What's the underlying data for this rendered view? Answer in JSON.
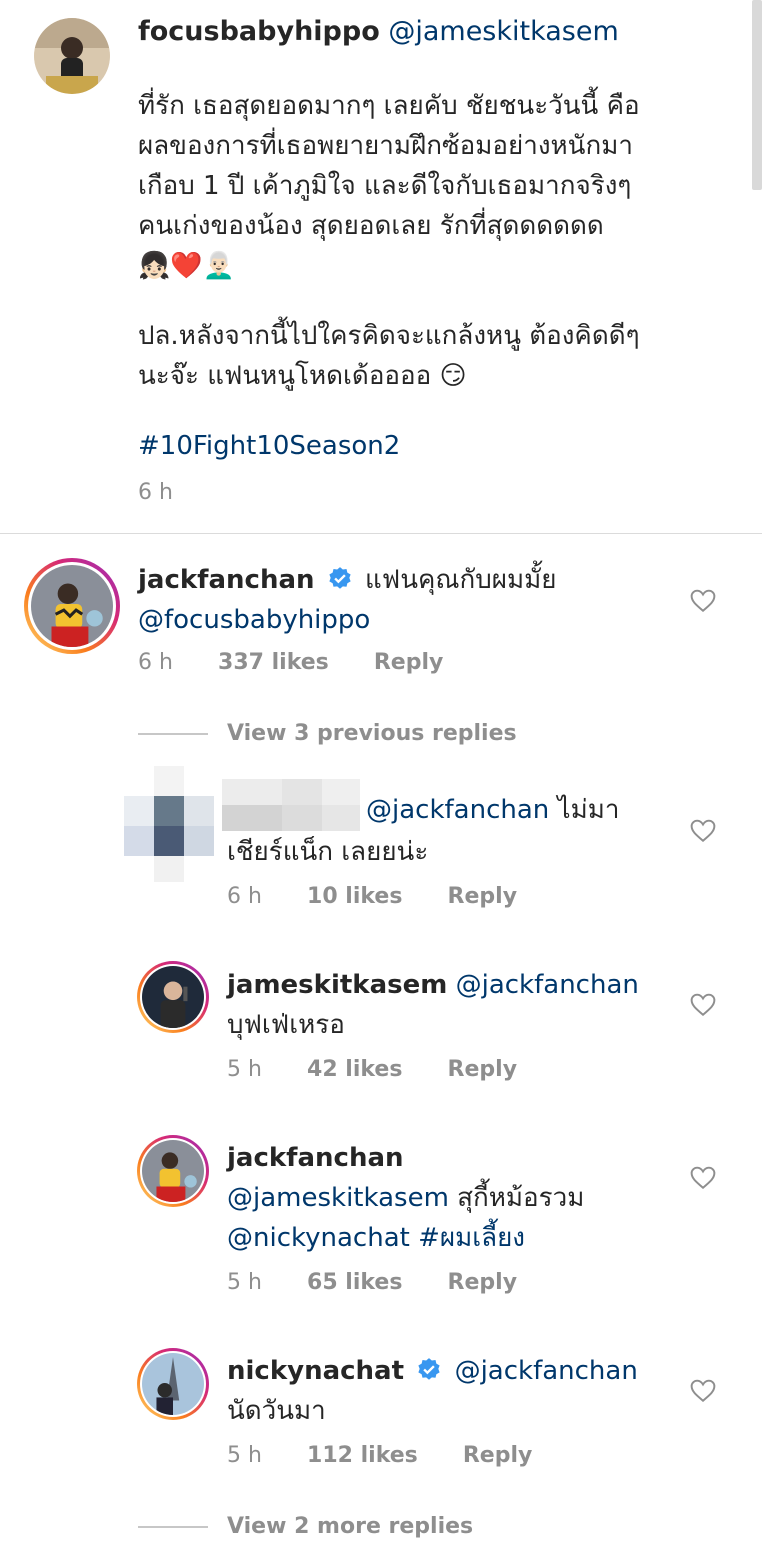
{
  "caption": {
    "username": "focusbabyhippo",
    "mention": "@jameskitkasem",
    "lines": [
      "ที่รัก เธอสุดยอดมากๆ เลยคับ ชัยชนะวันนี้ คือ",
      "ผลของการที่เธอพยายามฝึกซ้อมอย่างหนักมา",
      "เกือบ 1 ปี เค้าภูมิใจ และดีใจกับเธอมากจริงๆ",
      "คนเก่งของน้อง สุดยอดเลย รักที่สุดดดดดด",
      "👧🏻❤️👨🏻‍🦳"
    ],
    "ps_lines": [
      "ปล.หลังจากนี้ไปใครคิดจะแกล้งหนู ต้องคิดดีๆ",
      "นะจ๊ะ แฟนหนูโหดเด้ออออ 😏"
    ],
    "hashtag": "#10Fight10Season2",
    "time": "6 h"
  },
  "comments": [
    {
      "username": "jackfanchan",
      "verified": true,
      "text_line1": "แฟนคุณกับผมมั้ย",
      "mention": "@focusbabyhippo",
      "time": "6 h",
      "likes": "337 likes",
      "reply": "Reply"
    }
  ],
  "view_previous": "View 3 previous replies",
  "replies": [
    {
      "username_hidden": true,
      "mention": "@jackfanchan",
      "text_a": "ไม่มา",
      "text_b": "เชียร์แน็ก เลยยน่ะ",
      "time": "6 h",
      "likes": "10 likes",
      "reply": "Reply"
    },
    {
      "username": "jameskitkasem",
      "mention": "@jackfanchan",
      "text": "บุฟเฟ่เหรอ",
      "time": "5 h",
      "likes": "42 likes",
      "reply": "Reply"
    },
    {
      "username": "jackfanchan",
      "mention1": "@jameskitkasem",
      "text1": "สุกี้หม้อรวม",
      "mention2": "@nickynachat",
      "hashtag": "#ผมเลี้ยง",
      "time": "5 h",
      "likes": "65 likes",
      "reply": "Reply"
    },
    {
      "username": "nickynachat",
      "verified": true,
      "mention": "@jackfanchan",
      "text": "นัดวันมา",
      "time": "5 h",
      "likes": "112 likes",
      "reply": "Reply"
    }
  ],
  "view_more": "View 2 more replies",
  "colors": {
    "link": "#00376b",
    "meta": "#8e8e8e",
    "verified": "#3897f0"
  },
  "icons": [
    "heart-outline-icon",
    "verified-badge-icon"
  ]
}
